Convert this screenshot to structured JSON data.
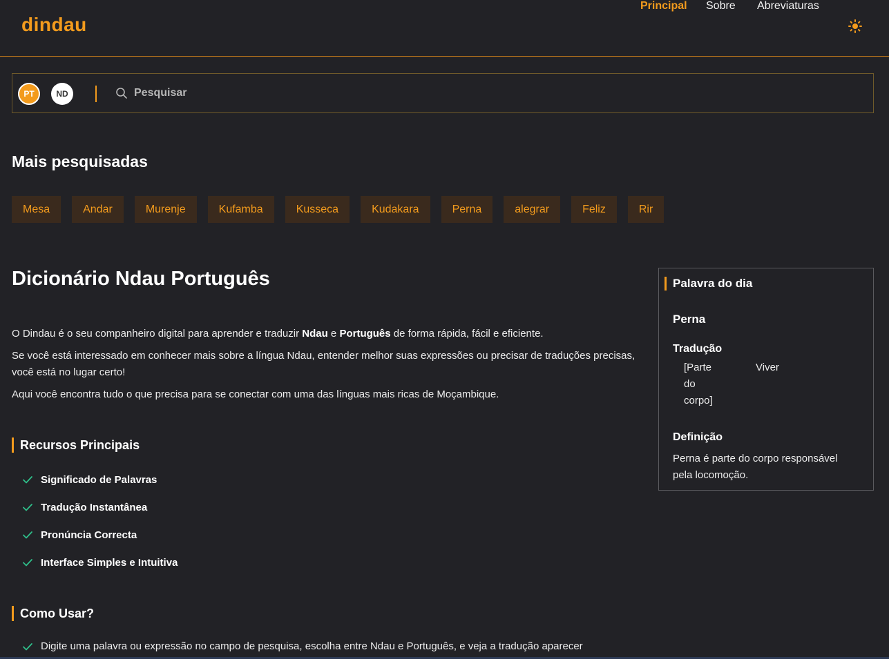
{
  "header": {
    "logo": "dindau",
    "nav": [
      "Principal",
      "Sobre",
      "Abreviaturas"
    ],
    "active_nav": "Principal",
    "theme_icon": "sun-icon"
  },
  "search": {
    "lang_pt": "PT",
    "lang_nd": "ND",
    "placeholder": "Pesquisar"
  },
  "popular": {
    "title": "Mais pesquisadas",
    "words": [
      "Mesa",
      "Andar",
      "Murenje",
      "Kufamba",
      "Kusseca",
      "Kudakara",
      "Perna",
      "alegrar",
      "Feliz",
      "Rir"
    ]
  },
  "main": {
    "title": "Dicionário Ndau Português",
    "intro_1_a": "O Dindau é o seu companheiro digital para aprender e traduzir ",
    "intro_1_b": "Ndau",
    "intro_1_c": " e ",
    "intro_1_d": "Português",
    "intro_1_e": " de forma rápida, fácil e eficiente.",
    "intro_2": "Se você está interessado em conhecer mais sobre a língua Ndau, entender melhor suas expressões ou precisar de traduções precisas, você está no lugar certo!",
    "intro_3": "Aqui você encontra tudo o que precisa para se conectar com uma das línguas mais ricas de Moçambique.",
    "features_title": "Recursos Principais",
    "features": [
      "Significado de Palavras",
      "Tradução Instantânea",
      "Pronúncia Correcta",
      "Interface Simples e Intuitiva"
    ],
    "usage_title": "Como Usar?",
    "usage_line": "Digite uma palavra ou expressão no campo de pesquisa, escolha entre Ndau e Português, e veja a tradução aparecer"
  },
  "word_of_day": {
    "title": "Palavra do dia",
    "word": "Perna",
    "translation_label": "Tradução",
    "translation_1": "[Parte do corpo]",
    "translation_2": "Viver",
    "definition_label": "Definição",
    "definition": "Perna é parte do corpo responsável pela locomoção."
  },
  "colors": {
    "accent": "#f39b1d",
    "background": "#222226",
    "chip_bg": "#3a2a1d",
    "check": "#2fbf8a"
  }
}
